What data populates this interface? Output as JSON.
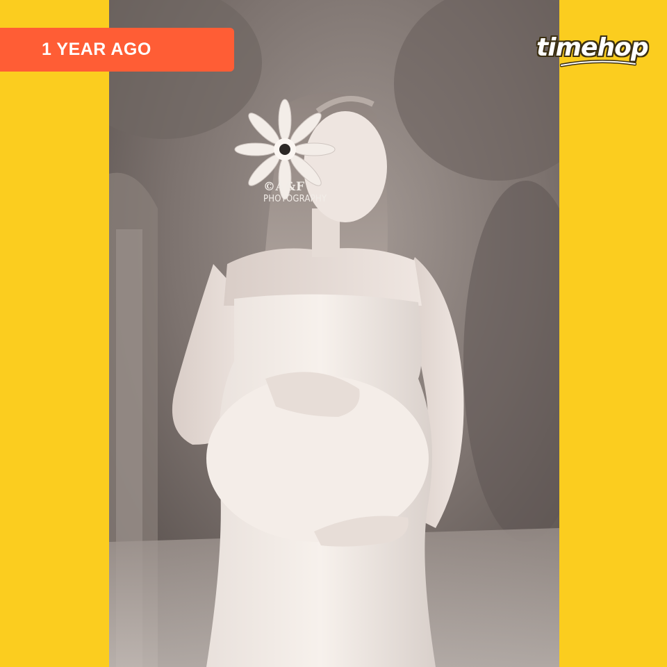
{
  "badge": {
    "label": "1 YEAR AGO",
    "color": "#ff5d35"
  },
  "logo": {
    "text": "timehop"
  },
  "photo": {
    "watermark_line1": "©A&F",
    "watermark_line2": "PHOTOGRAPHY"
  },
  "colors": {
    "background": "#fbcd1f",
    "badge_text": "#ffffff",
    "logo_fill": "#ffffff"
  }
}
